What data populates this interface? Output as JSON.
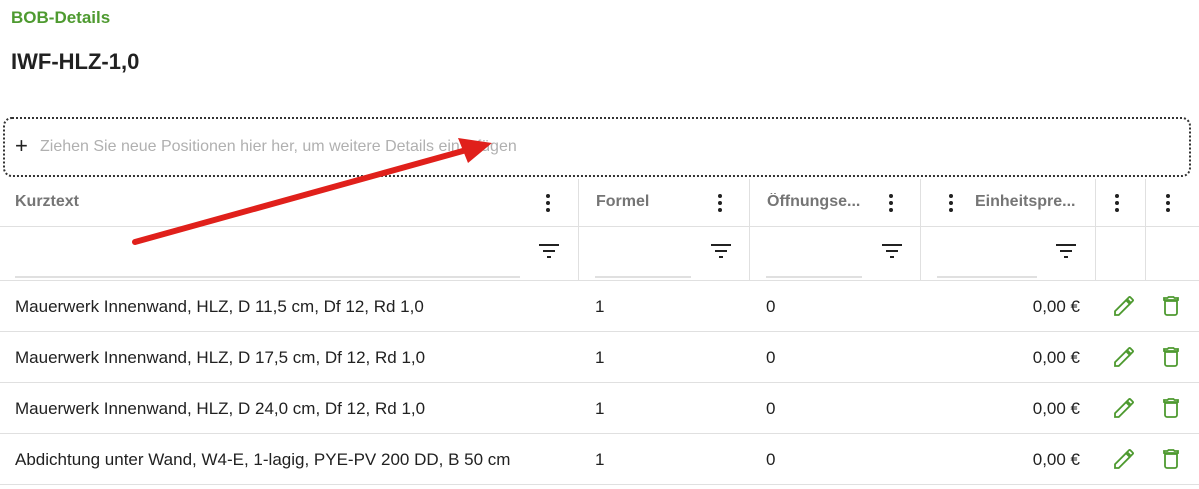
{
  "header": {
    "section_label": "BOB-Details",
    "title": "IWF-HLZ-1,0"
  },
  "dropzone": {
    "hint": "Ziehen Sie neue Positionen hier her, um weitere Details einzufügen",
    "icon": "plus-icon"
  },
  "table": {
    "columns": [
      {
        "label": "Kurztext"
      },
      {
        "label": "Formel"
      },
      {
        "label": "Öffnungse..."
      },
      {
        "label": "Einheitspre..."
      },
      {
        "label": ""
      },
      {
        "label": ""
      }
    ],
    "rows": [
      {
        "kurztext": "Mauerwerk Innenwand, HLZ, D 11,5 cm, Df 12, Rd 1,0",
        "formel": "1",
        "oeffnung": "0",
        "preis": "0,00 €"
      },
      {
        "kurztext": "Mauerwerk Innenwand, HLZ, D 17,5 cm, Df 12, Rd 1,0",
        "formel": "1",
        "oeffnung": "0",
        "preis": "0,00 €"
      },
      {
        "kurztext": "Mauerwerk Innenwand, HLZ, D 24,0 cm, Df 12, Rd 1,0",
        "formel": "1",
        "oeffnung": "0",
        "preis": "0,00 €"
      },
      {
        "kurztext": "Abdichtung unter Wand, W4-E, 1-lagig, PYE-PV 200 DD, B 50 cm",
        "formel": "1",
        "oeffnung": "0",
        "preis": "0,00 €"
      }
    ],
    "row_icons": [
      "edit-pencil-icon",
      "delete-trash-icon"
    ]
  },
  "colors": {
    "accent_green": "#4e9a30",
    "annotation_arrow": "#e0201b"
  }
}
